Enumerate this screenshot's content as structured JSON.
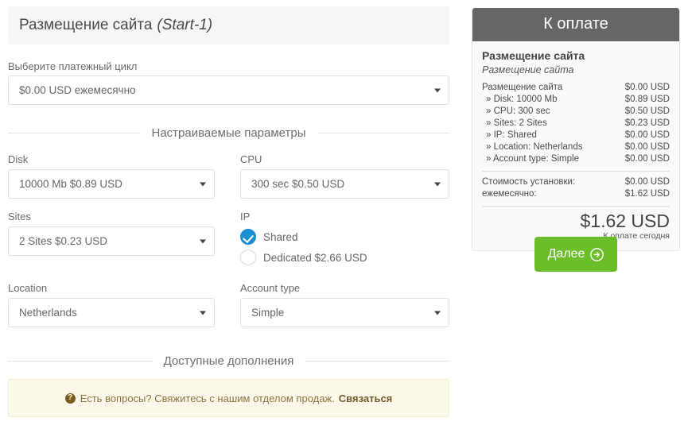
{
  "product": {
    "title": "Размещение сайта",
    "variant": "(Start-1)"
  },
  "billing": {
    "label": "Выберите платежный цикл",
    "selected": "$0.00 USD ежемесячно"
  },
  "sections": {
    "configurable": "Настраиваемые параметры",
    "addons": "Доступные дополнения"
  },
  "options": {
    "disk": {
      "label": "Disk",
      "value": "10000 Mb $0.89 USD"
    },
    "cpu": {
      "label": "CPU",
      "value": "300 sec $0.50 USD"
    },
    "sites": {
      "label": "Sites",
      "value": "2 Sites $0.23 USD"
    },
    "ip": {
      "label": "IP",
      "choices": [
        {
          "label": "Shared",
          "selected": true
        },
        {
          "label": "Dedicated $2.66 USD",
          "selected": false
        }
      ]
    },
    "location": {
      "label": "Location",
      "value": "Netherlands"
    },
    "account_type": {
      "label": "Account type",
      "value": "Simple"
    }
  },
  "notice": {
    "icon": "question-mark-icon",
    "text": "Есть вопросы? Свяжитесь с нашим отделом продаж.",
    "link": "Связаться"
  },
  "summary": {
    "heading": "К оплате",
    "product_name": "Размещение сайта",
    "product_sub": "Размещение сайта",
    "lines": [
      {
        "label": "Размещение сайта",
        "price": "$0.00 USD",
        "sub": false
      },
      {
        "label": "» Disk: 10000 Mb",
        "price": "$0.89 USD",
        "sub": true
      },
      {
        "label": "» CPU: 300 sec",
        "price": "$0.50 USD",
        "sub": true
      },
      {
        "label": "» Sites: 2 Sites",
        "price": "$0.23 USD",
        "sub": true
      },
      {
        "label": "» IP: Shared",
        "price": "$0.00 USD",
        "sub": true
      },
      {
        "label": "» Location: Netherlands",
        "price": "$0.00 USD",
        "sub": true
      },
      {
        "label": "» Account type: Simple",
        "price": "$0.00 USD",
        "sub": true
      }
    ],
    "totals": [
      {
        "label": "Стоимость установки:",
        "price": "$0.00 USD"
      },
      {
        "label": "ежемесячно:",
        "price": "$1.62 USD"
      }
    ],
    "grand_total": "$1.62 USD",
    "grand_caption": "К оплате сегодня"
  },
  "next_button": {
    "label": "Далее",
    "icon": "arrow-right-circle-icon"
  },
  "colors": {
    "accent_green": "#6cbd2a",
    "accent_blue": "#1b8fd1",
    "header_gray": "#666666",
    "notice_bg": "#fdf9ea"
  }
}
